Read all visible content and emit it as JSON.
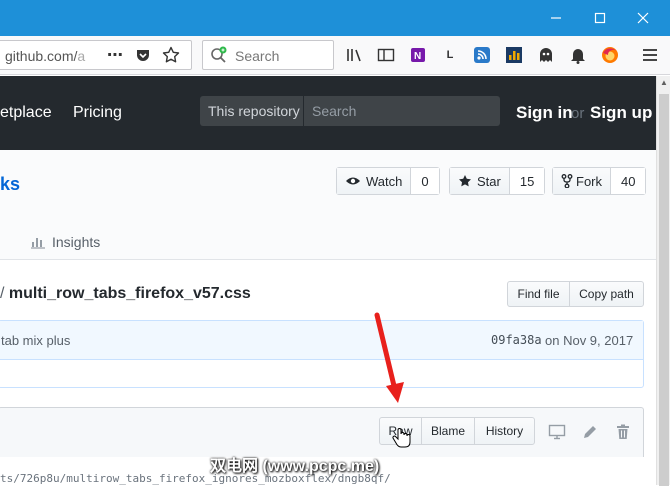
{
  "browser": {
    "url_host": "github.com/",
    "url_rest": "a",
    "search_placeholder": "Search",
    "menu_glyph": "⋯",
    "ext_l_label": "L"
  },
  "header": {
    "nav_marketplace": "etplace",
    "nav_pricing": "Pricing",
    "search_scope": "This repository",
    "search_placeholder": "Search",
    "sign_in": "Sign in",
    "or": "or",
    "sign_up": "Sign up"
  },
  "repo": {
    "name_fragment": "ks",
    "watch_label": "Watch",
    "watch_count": "0",
    "star_label": "Star",
    "star_count": "15",
    "fork_label": "Fork",
    "fork_count": "40",
    "tab_insights": "Insights"
  },
  "file": {
    "path_sep": "/",
    "filename": "multi_row_tabs_firefox_v57.css",
    "find_file": "Find file",
    "copy_path": "Copy path",
    "commit_message": "tab mix plus",
    "commit_sha": "09fa38a",
    "commit_date": "on Nov 9, 2017",
    "raw": "Raw",
    "blame": "Blame",
    "history": "History",
    "code_line": "ts/726p8u/multirow_tabs_firefox_ignores_mozboxflex/dngb8qf/"
  },
  "watermark": "双电网 (www.pcpc.me)",
  "colors": {
    "titlebar": "#1e90d8",
    "gh_header": "#24292e",
    "link": "#0366d6",
    "annotation_arrow": "#e8201c"
  }
}
